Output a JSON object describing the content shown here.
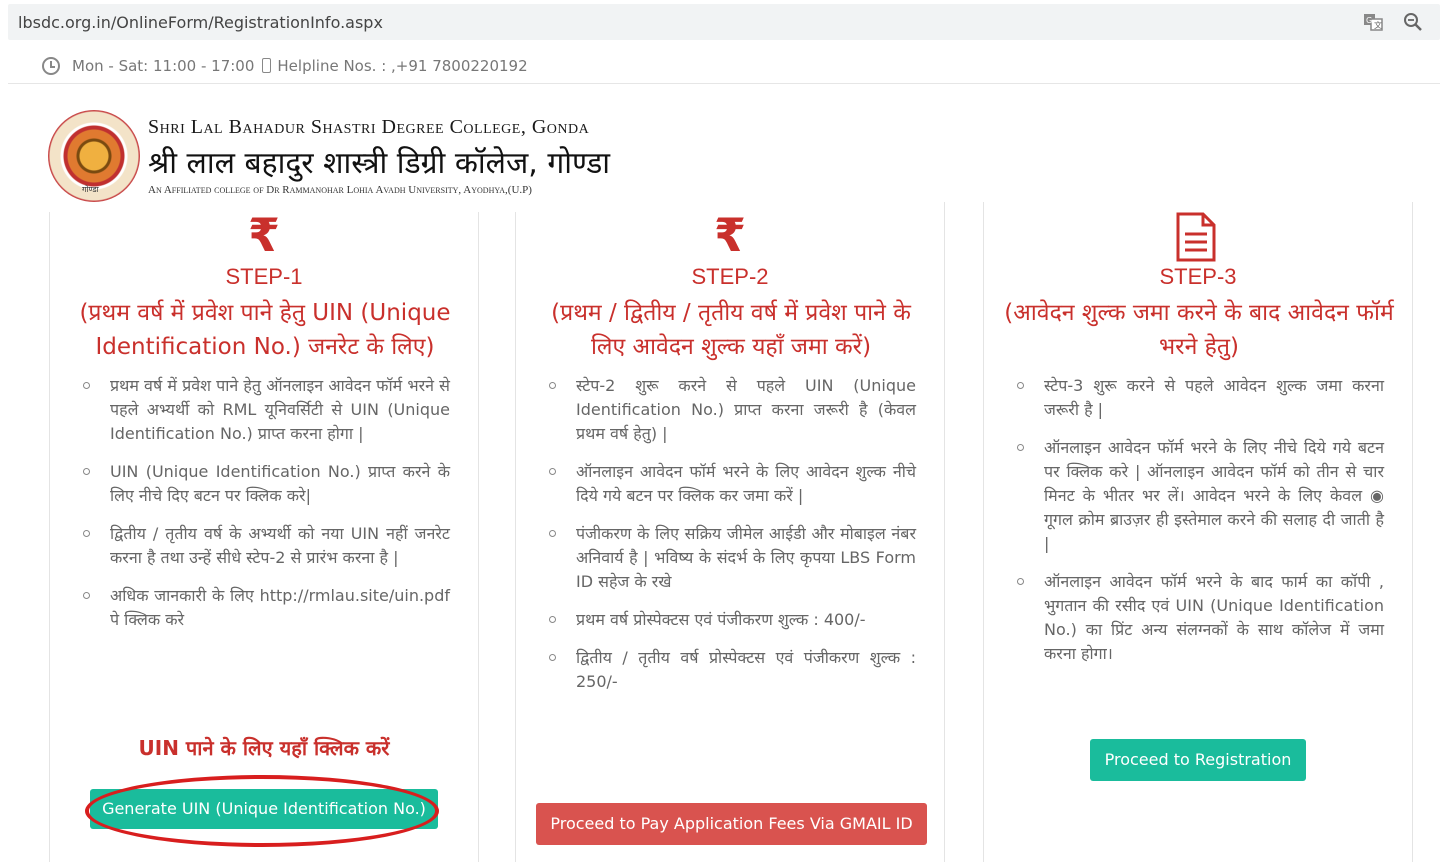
{
  "browser": {
    "url": "lbsdc.org.in/OnlineForm/RegistrationInfo.aspx",
    "icons": [
      "translate-icon",
      "zoom-icon"
    ]
  },
  "infobar": {
    "hours": "Mon - Sat: 11:00 - 17:00",
    "helpline": "Helpline Nos. : ,+91 7800220192"
  },
  "header": {
    "title_en": "Shri Lal Bahadur Shastri Degree College, Gonda",
    "title_hi": "श्री लाल बहादुर शास्त्री डिग्री कॉलेज, गोण्डा",
    "subtitle": "An Affiliated college of Dr Rammanohar Lohia Avadh University, Ayodhya,(U.P)",
    "logo_caption": "गोण्डा"
  },
  "colors": {
    "accent_red": "#c9302c",
    "green": "#1abc9c",
    "red_btn": "#d9534f"
  },
  "steps": [
    {
      "icon": "rupee-icon",
      "icon_glyph": "₹",
      "title": "STEP-1",
      "subtitle": "(प्रथम वर्ष में प्रवेश पाने हेतु UIN (Unique Identification No.) जनरेट के लिए)",
      "items": [
        "प्रथम वर्ष में प्रवेश पाने हेतु ऑनलाइन आवेदन फॉर्म भरने से पहले अभ्यर्थी को RML यूनिवर्सिटी से UIN (Unique Identification No.) प्राप्त करना होगा |",
        "UIN (Unique Identification No.) प्राप्त करने के लिए नीचे दिए बटन पर क्लिक करे|",
        "द्वितीय / तृतीय वर्ष के अभ्यर्थी को नया UIN नहीं जनरेट करना है तथा उन्हें सीधे स्टेप-2 से प्रारंभ करना है |",
        "अधिक जानकारी के लिए http://rmlau.site/uin.pdf पे क्लिक करे"
      ],
      "link": "UIN पाने के लिए यहाँ क्लिक करें",
      "button": "Generate UIN (Unique Identification No.)"
    },
    {
      "icon": "rupee-icon",
      "icon_glyph": "₹",
      "title": "STEP-2",
      "subtitle": "(प्रथम / द्वितीय / तृतीय वर्ष में प्रवेश पाने के लिए आवेदन शुल्क यहाँ जमा करें)",
      "items": [
        "स्टेप-2 शुरू करने से पहले UIN (Unique Identification No.) प्राप्त करना जरूरी है (केवल प्रथम वर्ष हेतु) |",
        "ऑनलाइन आवेदन फॉर्म भरने के लिए आवेदन शुल्क नीचे दिये गये बटन पर क्लिक कर जमा करें |",
        "पंजीकरण के लिए सक्रिय जीमेल आईडी और मोबाइल नंबर अनिवार्य है | भविष्य के संदर्भ के लिए कृपया LBS Form ID सहेज के रखे",
        "प्रथम वर्ष प्रोस्पेक्टस एवं पंजीकरण शुल्क : 400/-",
        "द्वितीय / तृतीय वर्ष प्रोस्पेक्टस एवं पंजीकरण शुल्क : 250/-"
      ],
      "button": "Proceed to Pay Application Fees Via GMAIL ID"
    },
    {
      "icon": "document-icon",
      "title": "STEP-3",
      "subtitle": "(आवेदन शुल्क जमा करने के बाद आवेदन फॉर्म भरने हेतु)",
      "items": [
        "स्टेप-3 शुरू करने से पहले आवेदन शुल्क जमा करना जरूरी है |",
        "ऑनलाइन आवेदन फॉर्म भरने के लिए नीचे दिये गये बटन पर क्लिक करे | ऑनलाइन आवेदन फॉर्म को तीन से चार मिनट के भीतर भर लें। आवेदन भरने के लिए केवल ◉ गूगल क्रोम ब्राउज़र ही इस्तेमाल करने की सलाह दी जाती है |",
        "ऑनलाइन आवेदन फॉर्म भरने के बाद फार्म का कॉपी , भुगतान की रसीद एवं UIN (Unique Identification No.) का प्रिंट अन्य संलग्नकों के साथ कॉलेज में जमा करना होगा।"
      ],
      "button": "Proceed to Registration"
    }
  ]
}
